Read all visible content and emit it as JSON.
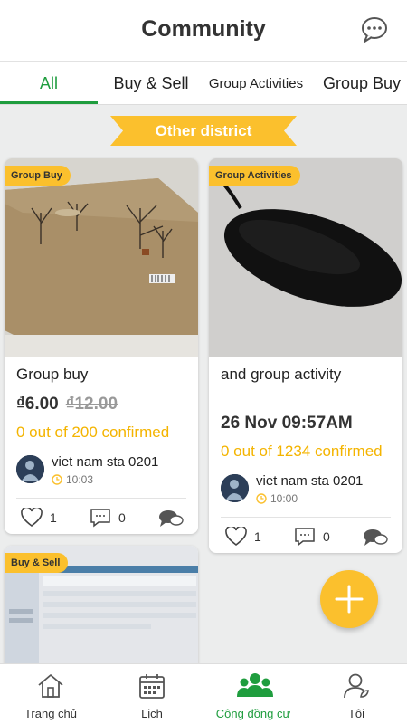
{
  "header": {
    "title": "Community"
  },
  "tabs": [
    {
      "label": "All"
    },
    {
      "label": "Buy & Sell"
    },
    {
      "label": "Group Activities"
    },
    {
      "label": "Group Buy"
    }
  ],
  "banner": {
    "label": "Other district"
  },
  "posts": [
    {
      "badge": "Group Buy",
      "title": "Group buy",
      "price": "₫6.00",
      "old_price": "₫12.00",
      "confirmed": "0 out of 200 confirmed",
      "user": "viet nam sta 0201",
      "time": "10:03",
      "likes": "1",
      "comments": "0"
    },
    {
      "badge": "Group Activities",
      "title": "and group activity",
      "datetime": "26 Nov 09:57AM",
      "confirmed": "0 out of 1234 confirmed",
      "user": "viet nam sta 0201",
      "time": "10:00",
      "likes": "1",
      "comments": "0"
    },
    {
      "badge": "Buy & Sell"
    }
  ],
  "nav": [
    {
      "label": "Trang chủ",
      "icon": "home-icon"
    },
    {
      "label": "Lịch",
      "icon": "calendar-icon"
    },
    {
      "label": "Cộng đồng cư",
      "icon": "community-icon"
    },
    {
      "label": "Tôi",
      "icon": "profile-icon"
    }
  ],
  "colors": {
    "accent": "#1f9d3e",
    "highlight": "#fbc02d",
    "confirmed": "#f4b400"
  }
}
